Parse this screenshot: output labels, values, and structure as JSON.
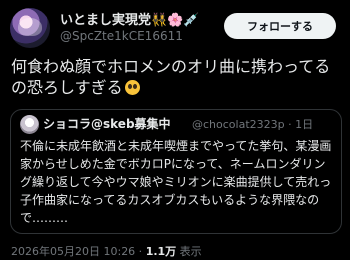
{
  "author": {
    "display_name": "いとまし実現党👯‍♀️🌸💉",
    "handle": "@SpcZte1kCE16611"
  },
  "follow_button_label": "フォローする",
  "post_text": "何食わぬ顔でホロメンのオリ曲に携わってるの恐ろしすぎる",
  "quote": {
    "display_name": "ショコラ@skeb募集中",
    "handle_time": "@chocolat2323p · 1日",
    "text": "不倫に未成年飲酒と未成年喫煙までやってた挙句、某漫画家からせしめた金でボカロPになって、ネームロンダリング繰り返して今やウマ娘やミリオンに楽曲提供して売れっ子作曲家になってるカスオブカスもいるような界隈なので………"
  },
  "meta": {
    "timestamp": "2026年05月20日 10:26 · ",
    "views_count": "1.1万",
    "views_label": " 表示"
  },
  "colors": {
    "background": "#000000",
    "text_primary": "#e7e9ea",
    "text_secondary": "#71767b",
    "button_bg": "#eff3f4",
    "border": "#2f3336"
  }
}
